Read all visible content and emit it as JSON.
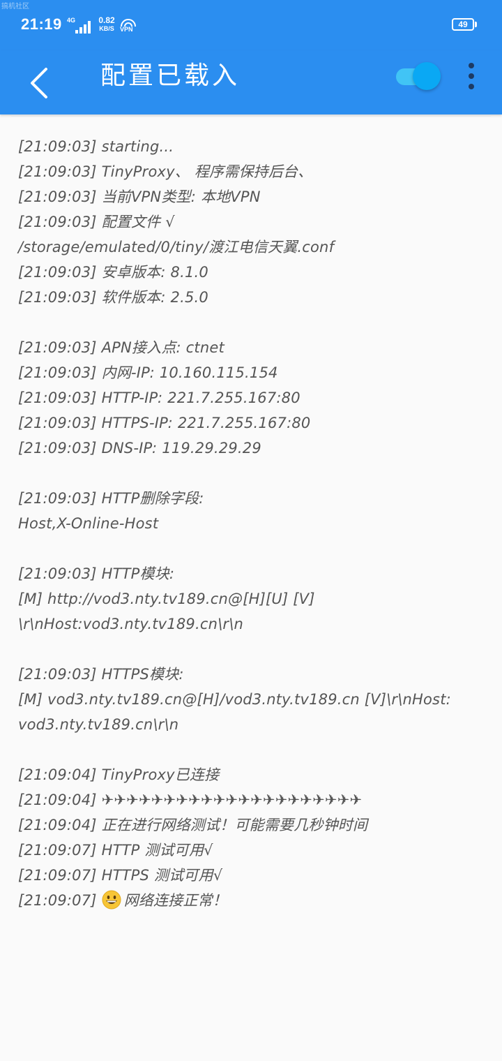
{
  "status_bar": {
    "watermark": "搞机社区",
    "time": "21:19",
    "network_type": "4G",
    "speed_value": "0.82",
    "speed_unit": "KB/S",
    "vpn_label": "VPN",
    "battery_level": "49"
  },
  "toolbar": {
    "title": "配置已载入",
    "vpn_toggle_on": true,
    "colors": {
      "bar": "#2b8ef0",
      "toggle_track": "#41c4f5",
      "toggle_thumb": "#0aa8f4",
      "menu_dots": "#1d3a63"
    }
  },
  "log": {
    "lines": [
      "[21:09:03] starting...",
      "[21:09:03] TinyProxy、 程序需保持后台、",
      "[21:09:03] 当前VPN类型: 本地VPN",
      "[21:09:03] 配置文件 √",
      "/storage/emulated/0/tiny/渡江电信天翼.conf",
      "[21:09:03] 安卓版本: 8.1.0",
      "[21:09:03] 软件版本: 2.5.0",
      "",
      "[21:09:03] APN接入点: ctnet",
      "[21:09:03] 内网-IP: 10.160.115.154",
      "[21:09:03] HTTP-IP: 221.7.255.167:80",
      "[21:09:03] HTTPS-IP: 221.7.255.167:80",
      "[21:09:03] DNS-IP: 119.29.29.29",
      "",
      "[21:09:03] HTTP删除字段:",
      "Host,X-Online-Host",
      "",
      "[21:09:03] HTTP模块:",
      "[M] http://vod3.nty.tv189.cn@[H][U] [V]",
      "\\r\\nHost:vod3.nty.tv189.cn\\r\\n",
      "",
      "[21:09:03] HTTPS模块:",
      "[M] vod3.nty.tv189.cn@[H]/vod3.nty.tv189.cn [V]\\r\\nHost:",
      "vod3.nty.tv189.cn\\r\\n",
      "",
      "[21:09:04] TinyProxy已连接",
      "[21:09:04] ✈✈✈✈✈✈✈✈✈✈✈✈✈✈✈✈✈✈✈✈✈",
      "[21:09:04] 正在进行网络测试！可能需要几秒钟时间",
      "[21:09:07] HTTP 测试可用√",
      "[21:09:07] HTTPS 测试可用√"
    ],
    "last_line_prefix": "[21:09:07] ",
    "last_line_emoji": "grinning-face-emoji",
    "last_line_text": "网络连接正常！"
  }
}
